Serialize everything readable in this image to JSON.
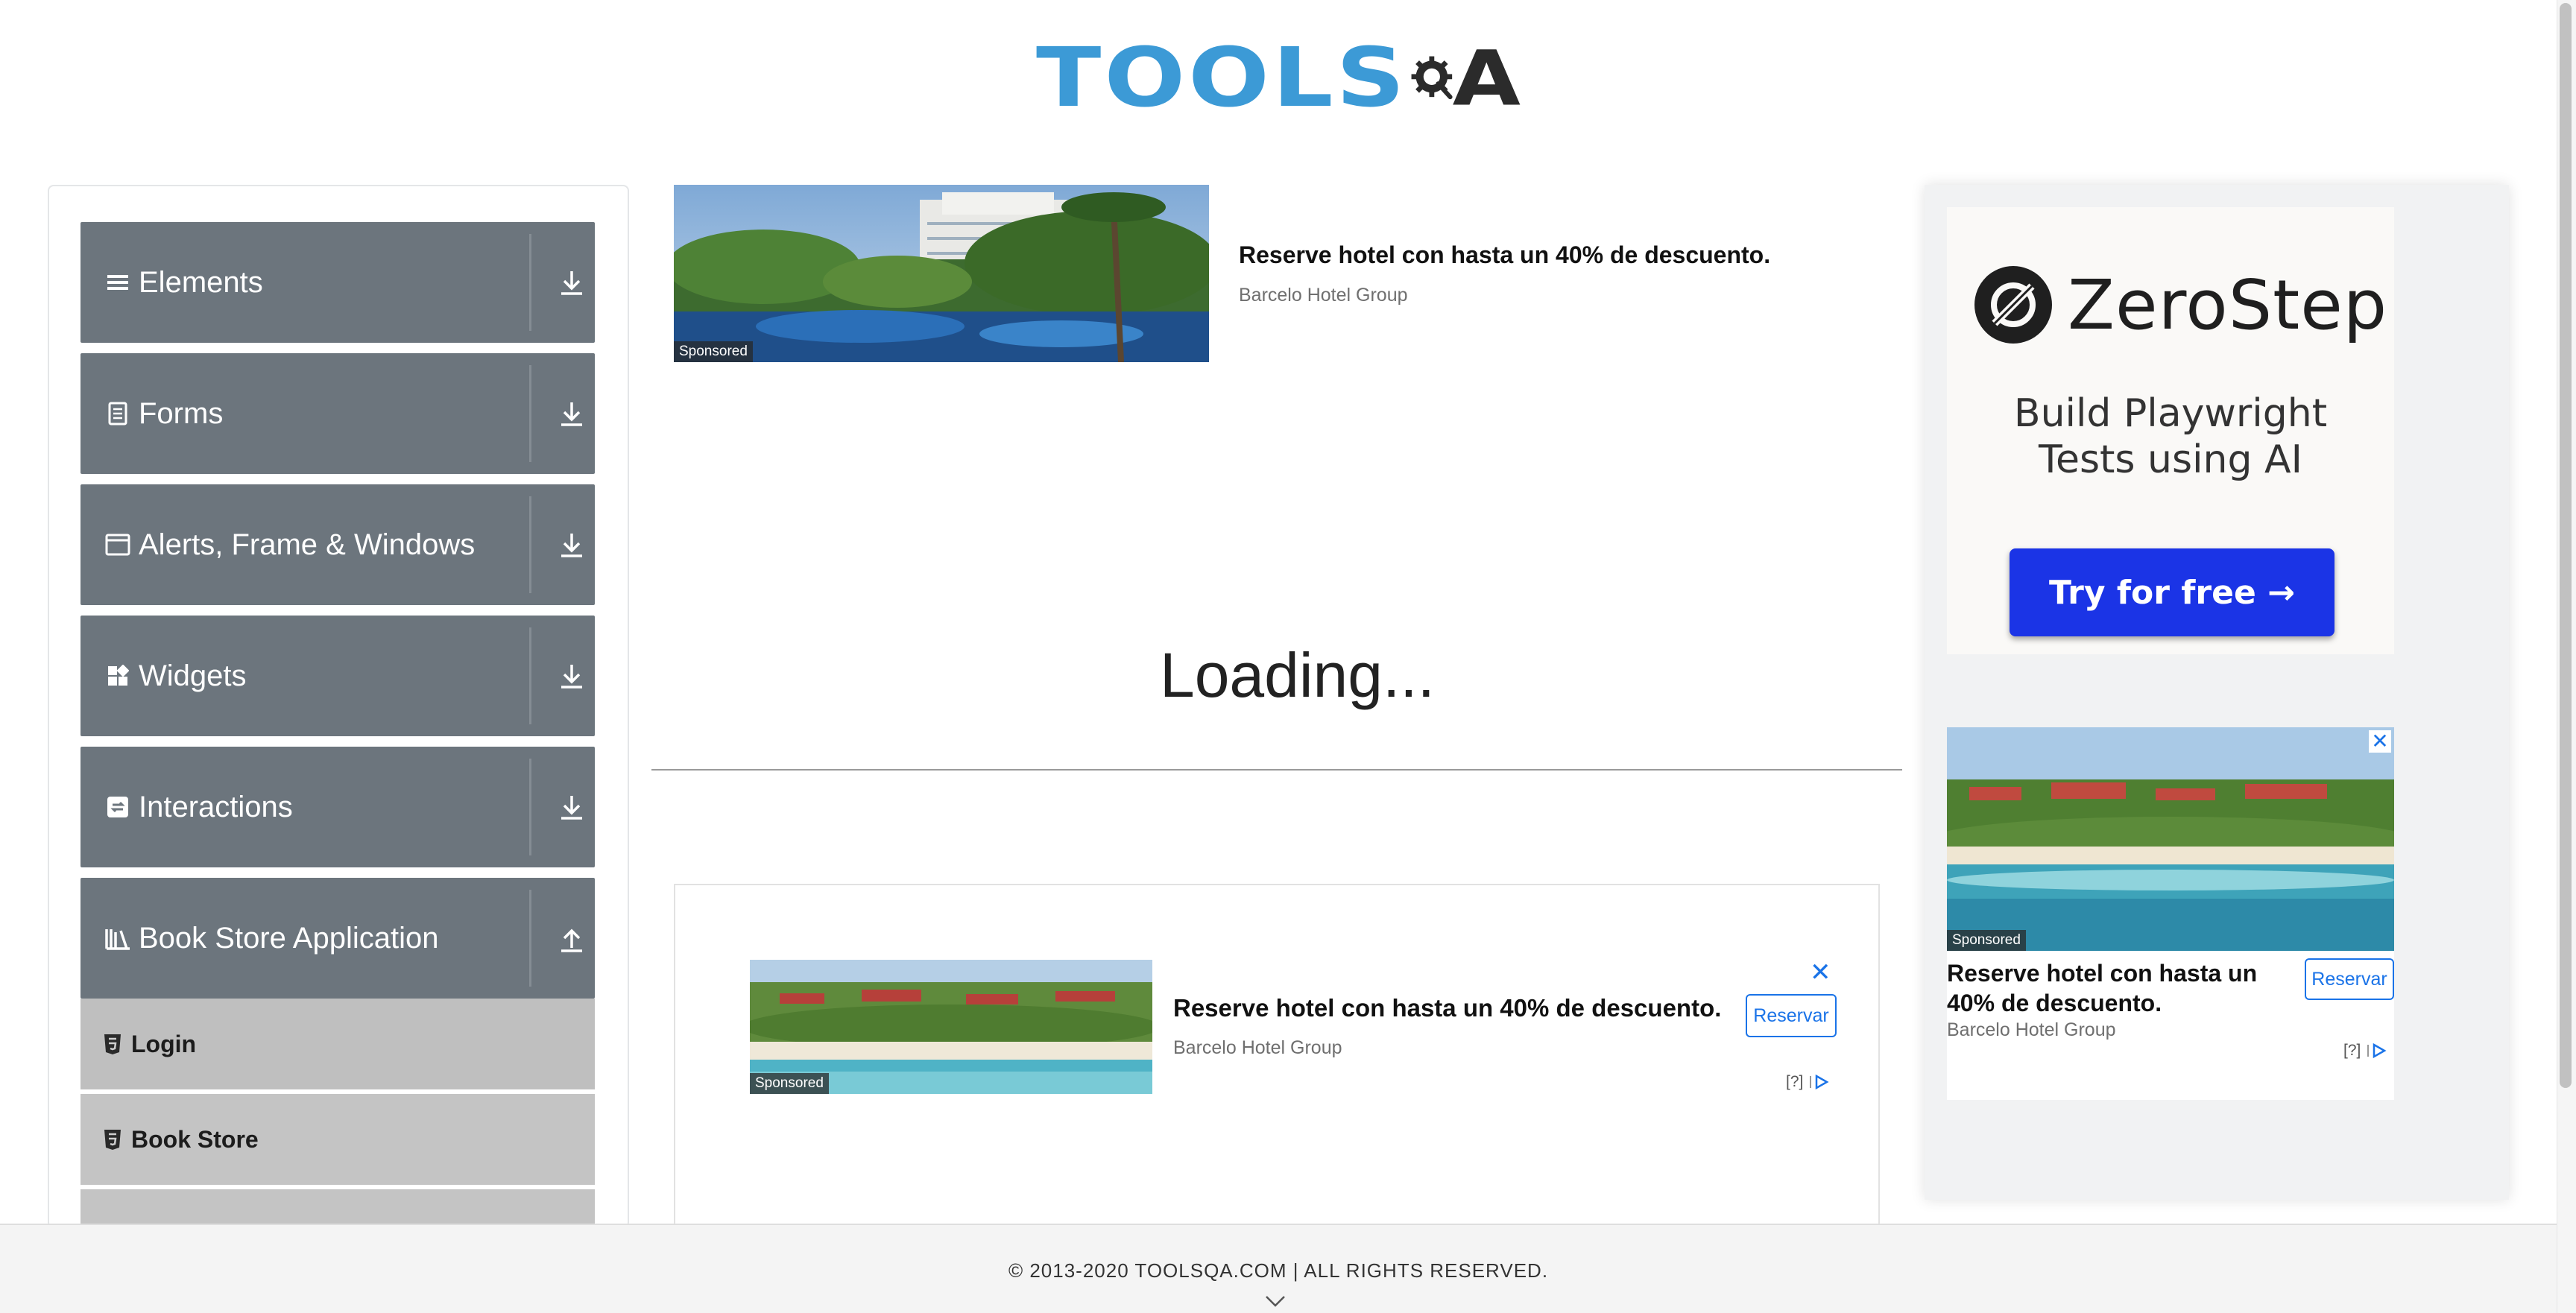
{
  "logo": {
    "text_main": "TOOLS",
    "text_end": "A"
  },
  "nav": {
    "groups": [
      {
        "label": "Elements",
        "icon": "hamburger-icon",
        "expanded": false
      },
      {
        "label": "Forms",
        "icon": "document-icon",
        "expanded": false
      },
      {
        "label": "Alerts, Frame & Windows",
        "icon": "window-icon",
        "expanded": false
      },
      {
        "label": "Widgets",
        "icon": "widgets-icon",
        "expanded": false
      },
      {
        "label": "Interactions",
        "icon": "interactions-icon",
        "expanded": false
      },
      {
        "label": "Book Store Application",
        "icon": "books-icon",
        "expanded": true
      }
    ],
    "book_store_items": [
      {
        "label": "Login",
        "icon": "html5-icon"
      },
      {
        "label": "Book Store",
        "icon": "html5-icon"
      }
    ]
  },
  "top_ad": {
    "sponsored": "Sponsored",
    "title": "Reserve hotel con hasta un 40% de descuento.",
    "advertiser": "Barcelo Hotel Group"
  },
  "main": {
    "loading_text": "Loading..."
  },
  "mid_ad": {
    "sponsored": "Sponsored",
    "title": "Reserve hotel con hasta un 40% de descuento.",
    "advertiser": "Barcelo Hotel Group",
    "cta": "Reservar",
    "close": "✕",
    "adchoices": "[?]"
  },
  "right_ad_zerostep": {
    "brand": "ZeroStep",
    "tagline_line1": "Build Playwright",
    "tagline_line2": "Tests using AI",
    "cta": "Try for free →"
  },
  "right_ad_hotel": {
    "sponsored": "Sponsored",
    "title": "Reserve hotel con hasta un 40% de descuento.",
    "advertiser": "Barcelo Hotel Group",
    "cta": "Reservar",
    "close": "✕",
    "adchoices": "[?]"
  },
  "footer": {
    "copyright": "© 2013-2020 TOOLSQA.COM | ALL RIGHTS RESERVED."
  },
  "colors": {
    "accent_blue": "#3c9ad6",
    "nav_gray": "#6c757d",
    "ad_blue": "#1a73e8",
    "zerostep_blue": "#1b34e6"
  }
}
